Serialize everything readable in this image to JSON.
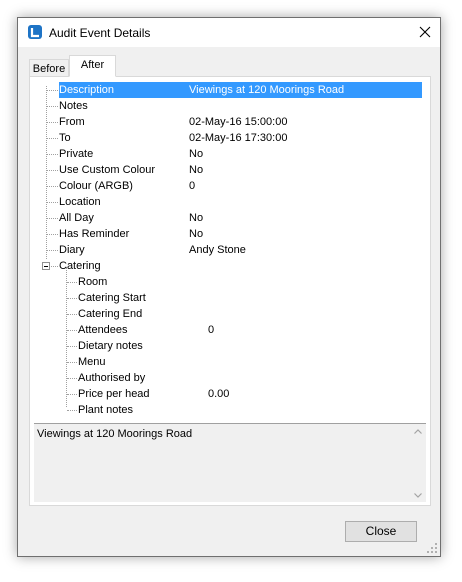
{
  "window": {
    "title": "Audit Event Details",
    "icon": "app-logo-icon",
    "close_icon": "close-icon"
  },
  "tabs": [
    {
      "label": "Before",
      "selected": false
    },
    {
      "label": "After",
      "selected": true
    }
  ],
  "properties": [
    {
      "label": "Description",
      "value": "Viewings at 120 Moorings Road",
      "selected": true
    },
    {
      "label": "Notes",
      "value": ""
    },
    {
      "label": "From",
      "value": "02-May-16 15:00:00"
    },
    {
      "label": "To",
      "value": "02-May-16 17:30:00"
    },
    {
      "label": "Private",
      "value": "No"
    },
    {
      "label": "Use Custom Colour",
      "value": "No"
    },
    {
      "label": "Colour (ARGB)",
      "value": "0"
    },
    {
      "label": "Location",
      "value": ""
    },
    {
      "label": "All Day",
      "value": "No"
    },
    {
      "label": "Has Reminder",
      "value": "No"
    },
    {
      "label": "Diary",
      "value": "Andy Stone"
    }
  ],
  "catering": {
    "label": "Catering",
    "expanded": true,
    "children": [
      {
        "label": "Room",
        "value": ""
      },
      {
        "label": "Catering Start",
        "value": ""
      },
      {
        "label": "Catering End",
        "value": ""
      },
      {
        "label": "Attendees",
        "value": "0"
      },
      {
        "label": "Dietary notes",
        "value": ""
      },
      {
        "label": "Menu",
        "value": ""
      },
      {
        "label": "Authorised by",
        "value": ""
      },
      {
        "label": "Price per head",
        "value": "0.00"
      },
      {
        "label": "Plant notes",
        "value": ""
      }
    ]
  },
  "description_panel": {
    "text": "Viewings at 120 Moorings Road"
  },
  "buttons": {
    "close_label": "Close"
  },
  "colors": {
    "selection": "#3399ff",
    "window_bg": "#f0f0f0"
  }
}
